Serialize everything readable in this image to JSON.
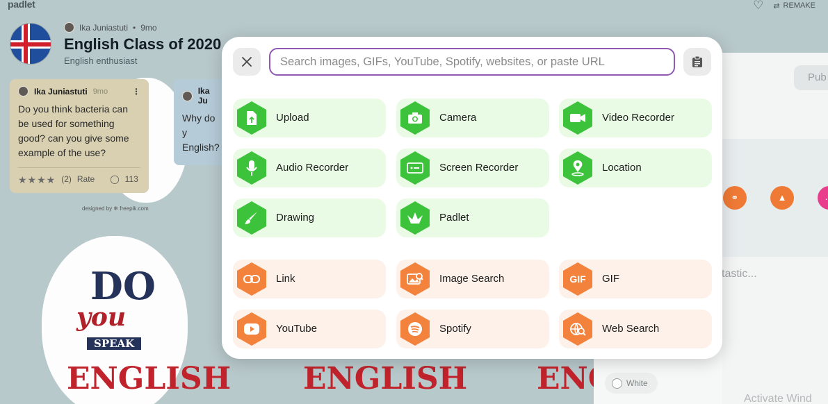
{
  "board": {
    "logo": "padlet",
    "remake_label": "REMAKE",
    "author": "Ika Juniastuti",
    "time": "9mo",
    "title": "English Class of 2020",
    "subtitle": "English enthusiast",
    "publish_label": "Pub",
    "fantastic_text": "tastic...",
    "white_label": "White",
    "activate_text": "Activate Wind",
    "freepik_credit": "designed by ❄ freepik.com",
    "art_do": "DO",
    "art_you": "you",
    "art_speak": "SPEAK",
    "art_english": "ENGLISH"
  },
  "posts": [
    {
      "author": "Ika Juniastuti",
      "time": "9mo",
      "text": "Do you think bacteria can be used for something good? can you give some example of the use?",
      "rating_count": "(2)",
      "rate_label": "Rate",
      "comments": "113"
    },
    {
      "author": "Ika Ju",
      "text": "Why do y English?"
    }
  ],
  "modal": {
    "search_placeholder": "Search images, GIFs, YouTube, Spotify, websites, or paste URL",
    "search_value": "",
    "options_green": [
      {
        "label": "Upload",
        "icon": "upload-file-icon"
      },
      {
        "label": "Camera",
        "icon": "camera-icon"
      },
      {
        "label": "Video Recorder",
        "icon": "video-camera-icon"
      },
      {
        "label": "Audio Recorder",
        "icon": "microphone-icon"
      },
      {
        "label": "Screen Recorder",
        "icon": "screen-record-icon"
      },
      {
        "label": "Location",
        "icon": "location-pin-icon"
      },
      {
        "label": "Drawing",
        "icon": "brush-icon"
      },
      {
        "label": "Padlet",
        "icon": "padlet-bird-icon"
      }
    ],
    "options_orange": [
      {
        "label": "Link",
        "icon": "link-icon"
      },
      {
        "label": "Image Search",
        "icon": "image-search-icon"
      },
      {
        "label": "GIF",
        "icon": "gif-icon"
      },
      {
        "label": "YouTube",
        "icon": "youtube-icon"
      },
      {
        "label": "Spotify",
        "icon": "spotify-icon"
      },
      {
        "label": "Web Search",
        "icon": "globe-search-icon"
      }
    ],
    "gif_icon_text": "GIF"
  },
  "colors": {
    "green_tile": "#e9fbe5",
    "green_icon": "#3dc33b",
    "orange_tile": "#fdf1e9",
    "orange_icon": "#f3823c",
    "search_border": "#8e58b3"
  }
}
